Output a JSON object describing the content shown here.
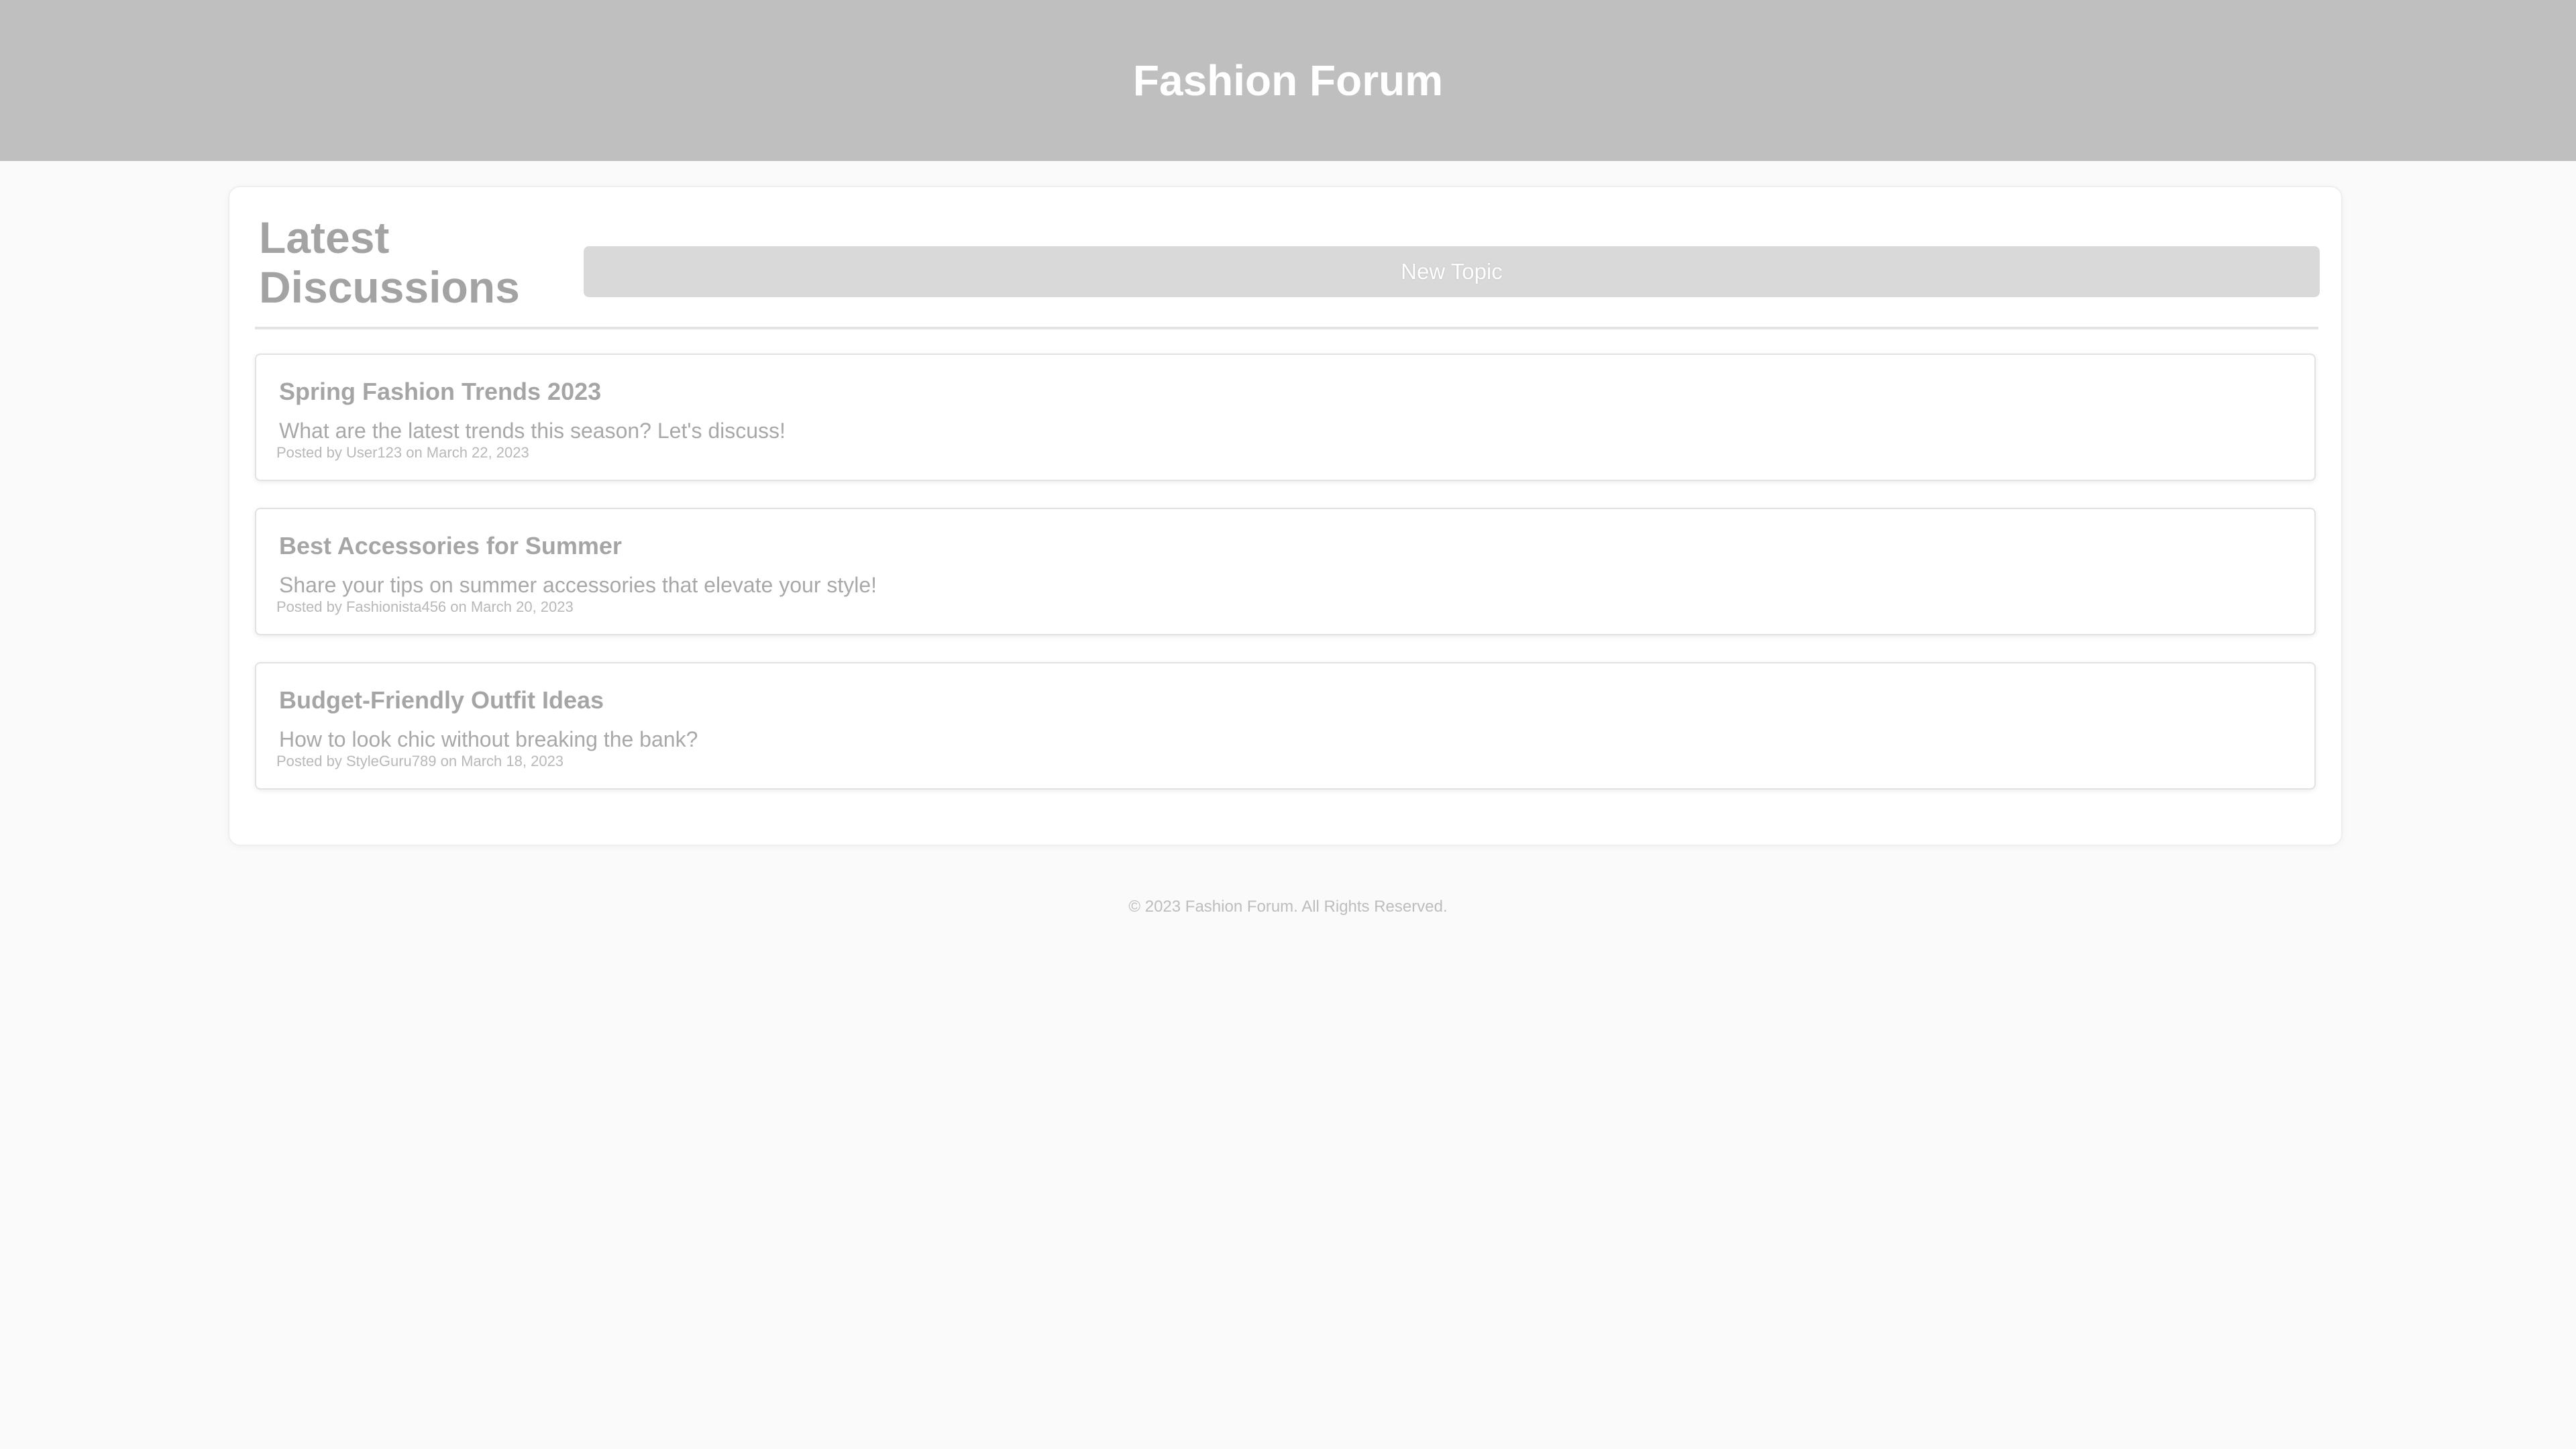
{
  "header": {
    "title": "Fashion Forum"
  },
  "main": {
    "section_title": "Latest Discussions",
    "new_topic_label": "New Topic",
    "topics": [
      {
        "title": "Spring Fashion Trends 2023",
        "text": "What are the latest trends this season? Let's discuss!",
        "meta": "Posted by User123 on March 22, 2023"
      },
      {
        "title": "Best Accessories for Summer",
        "text": "Share your tips on summer accessories that elevate your style!",
        "meta": "Posted by Fashionista456 on March 20, 2023"
      },
      {
        "title": "Budget-Friendly Outfit Ideas",
        "text": "How to look chic without breaking the bank?",
        "meta": "Posted by StyleGuru789 on March 18, 2023"
      }
    ]
  },
  "footer": {
    "text": "© 2023 Fashion Forum. All Rights Reserved."
  }
}
